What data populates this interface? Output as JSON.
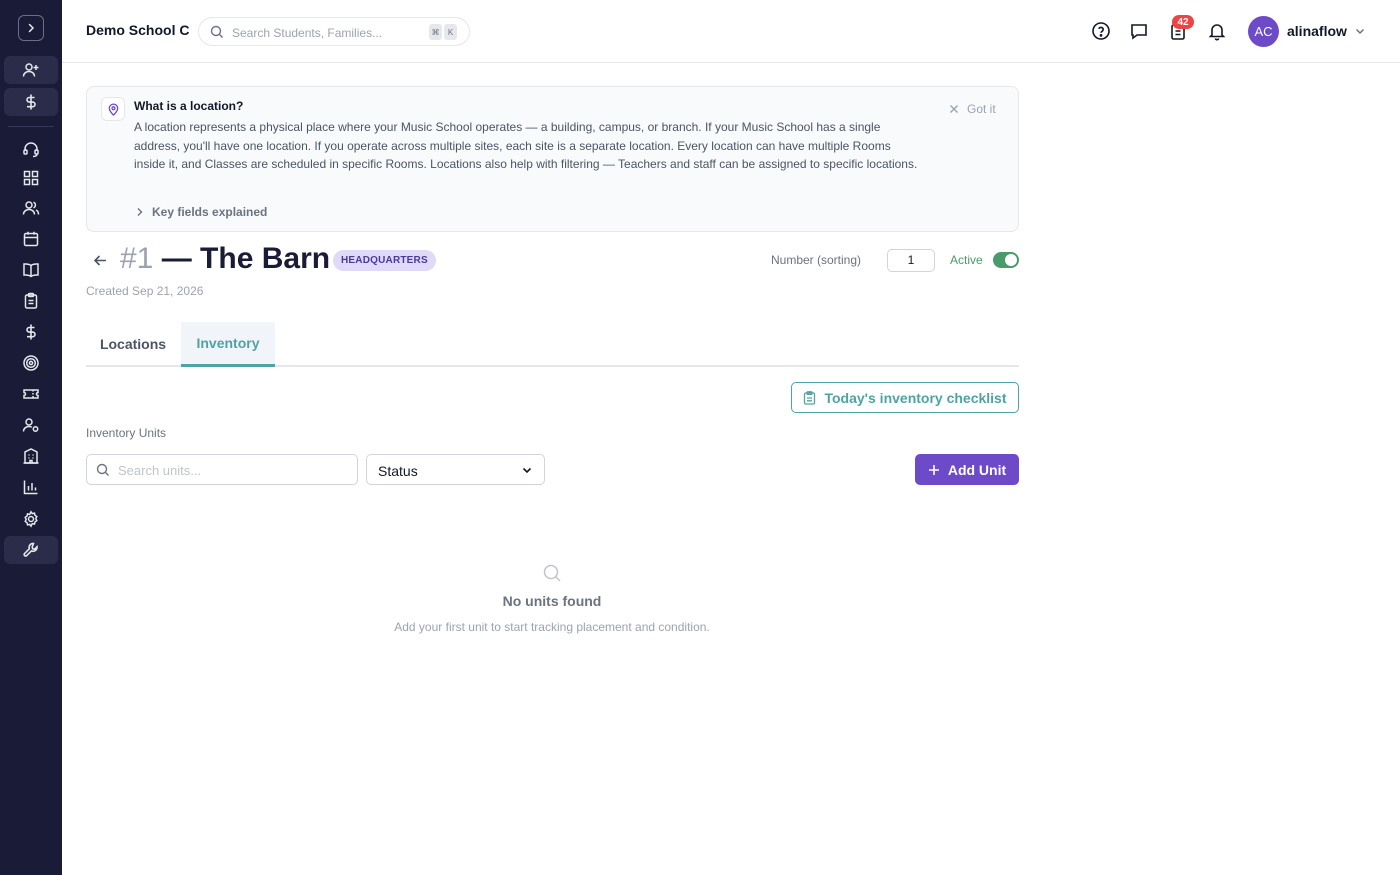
{
  "header": {
    "school_name": "Demo School C",
    "search_placeholder": "Search Students, Families...",
    "shortcut_keys": [
      "⌘",
      "K"
    ],
    "notification_count": "42",
    "user_initials": "AC",
    "username": "alinaflow"
  },
  "info_box": {
    "title": "What is a location?",
    "body": "A location represents a physical place where your Music School operates — a building, campus, or branch. If your Music School has a single address, you'll have one location. If you operate across multiple sites, each site is a separate location. Every location can have multiple Rooms inside it, and Classes are scheduled in specific Rooms. Locations also help with filtering — Teachers and staff can be assigned to specific locations.",
    "dismiss_label": "Got it",
    "expand_label": "Key fields explained"
  },
  "location": {
    "number": "#1",
    "name": "— The Barn",
    "badge": "HEADQUARTERS",
    "created": "Created Sep 21, 2026",
    "sort_label": "Number (sorting)",
    "sort_value": "1",
    "active_label": "Active",
    "active": true
  },
  "tabs": [
    {
      "label": "Locations",
      "selected": false
    },
    {
      "label": "Inventory",
      "selected": true
    }
  ],
  "inventory": {
    "checklist_button": "Today's inventory checklist",
    "section_label": "Inventory Units",
    "search_placeholder": "Search units...",
    "status_filter": "Status",
    "add_button": "Add Unit",
    "empty_title": "No units found",
    "empty_subtitle": "Add your first unit to start tracking placement and condition."
  },
  "colors": {
    "sidebar_bg": "#1a1b36",
    "primary": "#6d4ac8",
    "teal": "#4fa3a3",
    "active_green": "#4a9a6a",
    "badge_red": "#ef4444"
  }
}
